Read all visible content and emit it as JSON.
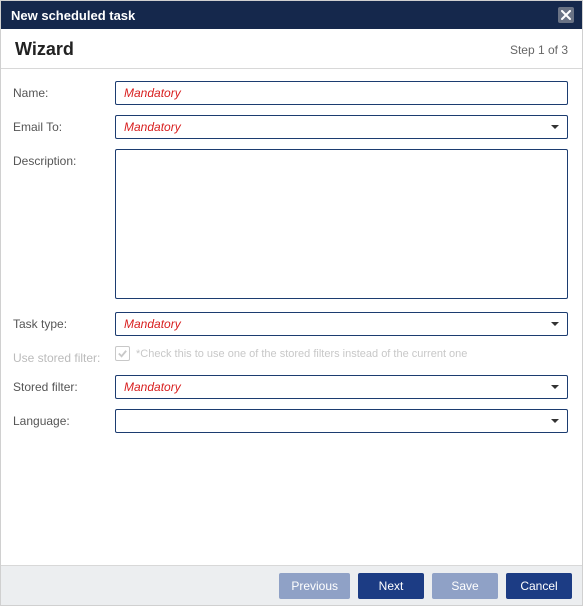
{
  "dialog": {
    "title": "New scheduled task"
  },
  "header": {
    "title": "Wizard",
    "step": "Step 1 of 3"
  },
  "labels": {
    "name": "Name:",
    "emailTo": "Email To:",
    "description": "Description:",
    "taskType": "Task type:",
    "useStored": "Use stored filter:",
    "storedFilter": "Stored filter:",
    "language": "Language:"
  },
  "placeholders": {
    "mandatory": "Mandatory"
  },
  "hints": {
    "useStored": "*Check this to use one of the stored filters instead of the current one"
  },
  "values": {
    "name": "",
    "emailTo": "",
    "description": "",
    "taskType": "",
    "storedFilter": "",
    "language": ""
  },
  "buttons": {
    "previous": "Previous",
    "next": "Next",
    "save": "Save",
    "cancel": "Cancel"
  }
}
